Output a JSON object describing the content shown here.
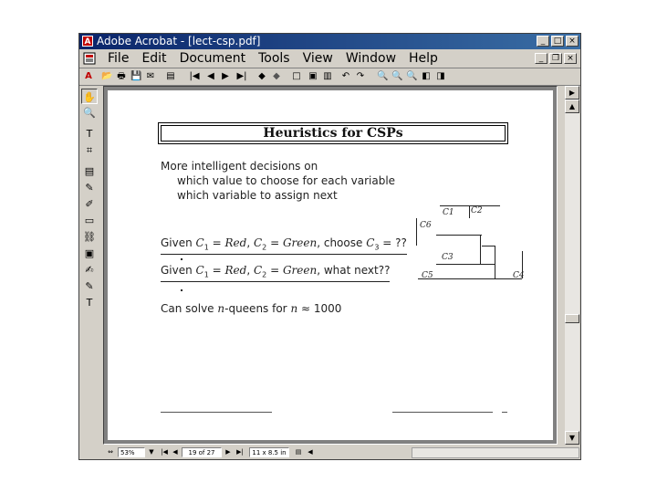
{
  "window": {
    "title": "Adobe Acrobat - [lect-csp.pdf]",
    "app_icon": "acrobat-icon",
    "buttons": {
      "minimize": "_",
      "maximize": "□",
      "close": "×"
    },
    "doc_buttons": {
      "minimize": "_",
      "restore": "❐",
      "close": "×"
    }
  },
  "menu": {
    "items": [
      "File",
      "Edit",
      "Document",
      "Tools",
      "View",
      "Window",
      "Help"
    ]
  },
  "toolbar": {
    "icons": [
      "acrobat-logo-icon",
      "open-icon",
      "print-icon",
      "save-icon",
      "email-icon",
      "show-hide-nav-icon",
      "first-page-icon",
      "prev-page-icon",
      "next-page-icon",
      "last-page-icon",
      "go-back-icon",
      "go-forward-icon",
      "actual-size-icon",
      "fit-page-icon",
      "fit-width-icon",
      "rotate-left-icon",
      "rotate-right-icon",
      "find-icon",
      "search-icon",
      "search-results-icon",
      "prev-highlight-icon",
      "next-highlight-icon"
    ],
    "glyphs": [
      "A",
      "📂",
      "🖶",
      "💾",
      "✉",
      "▤",
      "|◀",
      "◀",
      "▶",
      "▶|",
      "◆",
      "◆",
      "□",
      "▣",
      "▥",
      "↶",
      "↷",
      "🔍",
      "🔍",
      "🔍",
      "◧",
      "◨"
    ]
  },
  "palette": {
    "icons": [
      "hand-tool-icon",
      "zoom-tool-icon",
      "text-select-icon",
      "crop-tool-icon",
      "article-tool-icon",
      "pencil-tool-icon",
      "highlight-tool-icon",
      "form-tool-icon",
      "link-tool-icon",
      "movie-tool-icon",
      "touchup-tool-icon",
      "note-tool-icon",
      "text-touchup-icon"
    ],
    "glyphs": [
      "✋",
      "🔍",
      "T",
      "⌗",
      "▤",
      "✎",
      "✐",
      "▭",
      "⛓",
      "▣",
      "✍",
      "✎",
      "T"
    ]
  },
  "slide": {
    "title": "Heuristics for CSPs",
    "line1": "More intelligent decisions on",
    "line2": "which value to choose for each variable",
    "line3": "which variable to assign next",
    "given1_a": "Given ",
    "given1_b": "C",
    "given1_c": "1",
    "given1_d": " = ",
    "given1_e": "Red",
    "given1_f": ", ",
    "given1_g": "C",
    "given1_h": "2",
    "given1_i": " = ",
    "given1_j": "Green",
    "given1_k": ", choose ",
    "given1_l": "C",
    "given1_m": "3",
    "given1_n": " = ??",
    "given2_a": "Given ",
    "given2_b": "C",
    "given2_c": "1",
    "given2_d": " = ",
    "given2_e": "Red",
    "given2_f": ", ",
    "given2_g": "C",
    "given2_h": "2",
    "given2_i": " = ",
    "given2_j": "Green",
    "given2_k": ", what next??",
    "nqueens_a": "Can solve ",
    "nqueens_b": "n",
    "nqueens_c": "-queens for ",
    "nqueens_d": "n",
    "nqueens_e": " ≈ 1000",
    "graph_labels": {
      "c1": "C1",
      "c2": "C2",
      "c3": "C3",
      "c4": "C4",
      "c5": "C5",
      "c6": "C6"
    }
  },
  "status": {
    "zoom": "53%",
    "page": "19 of 27",
    "page_size": "11 x 8.5 in"
  }
}
